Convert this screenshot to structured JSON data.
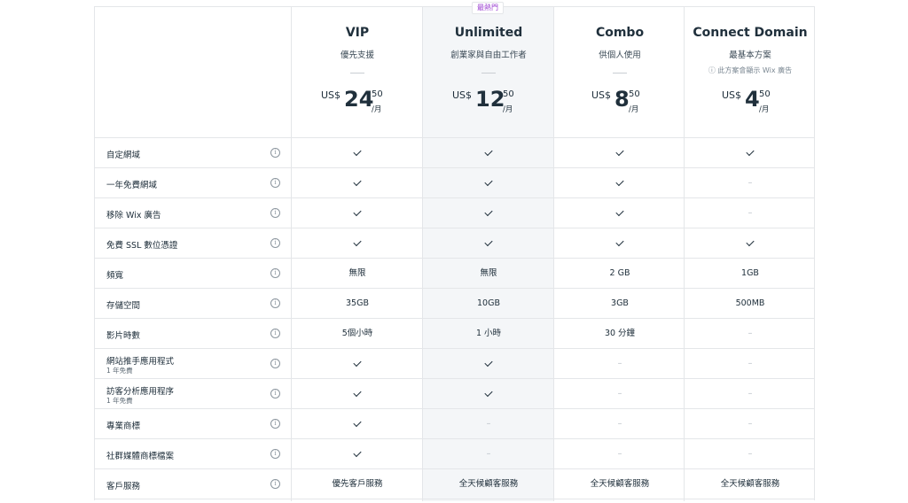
{
  "badge": "最熱門",
  "plans": [
    {
      "name": "VIP",
      "desc": "優先支援",
      "note": "",
      "currency": "US$",
      "int": "24",
      "dec": "50",
      "per": "/月"
    },
    {
      "name": "Unlimited",
      "desc": "創業家與自由工作者",
      "note": "",
      "currency": "US$",
      "int": "12",
      "dec": "50",
      "per": "/月"
    },
    {
      "name": "Combo",
      "desc": "供個人使用",
      "note": "",
      "currency": "US$",
      "int": "8",
      "dec": "50",
      "per": "/月"
    },
    {
      "name": "Connect Domain",
      "desc": "最基本方案",
      "note": "ⓘ 此方案會顯示 Wix 廣告",
      "currency": "US$",
      "int": "4",
      "dec": "50",
      "per": "/月"
    }
  ],
  "dash": "–",
  "features": [
    {
      "label": "自定網域",
      "sub": "",
      "values": [
        "check",
        "check",
        "check",
        "check"
      ]
    },
    {
      "label": "一年免費網域",
      "sub": "",
      "values": [
        "check",
        "check",
        "check",
        "dash"
      ]
    },
    {
      "label": "移除 Wix 廣告",
      "sub": "",
      "values": [
        "check",
        "check",
        "check",
        "dash"
      ]
    },
    {
      "label": "免費 SSL 數位憑證",
      "sub": "",
      "values": [
        "check",
        "check",
        "check",
        "check"
      ]
    },
    {
      "label": "頻寬",
      "sub": "",
      "values": [
        "無限",
        "無限",
        "2 GB",
        "1GB"
      ]
    },
    {
      "label": "存儲空間",
      "sub": "",
      "values": [
        "35GB",
        "10GB",
        "3GB",
        "500MB"
      ]
    },
    {
      "label": "影片時數",
      "sub": "",
      "values": [
        "5個小時",
        "1 小時",
        "30 分鐘",
        "dash"
      ]
    },
    {
      "label": "網站推手應用程式",
      "sub": "1 年免費",
      "values": [
        "check",
        "check",
        "dash",
        "dash"
      ]
    },
    {
      "label": "訪客分析應用程序",
      "sub": "1 年免費",
      "values": [
        "check",
        "check",
        "dash",
        "dash"
      ]
    },
    {
      "label": "專業商標",
      "sub": "",
      "values": [
        "check",
        "dash",
        "dash",
        "dash"
      ]
    },
    {
      "label": "社群媒體商標檔案",
      "sub": "",
      "values": [
        "check",
        "dash",
        "dash",
        "dash"
      ]
    },
    {
      "label": "客戶服務",
      "sub": "",
      "values": [
        "優先客戶服務",
        "全天候顧客服務",
        "全天候顧客服務",
        "全天候顧客服務"
      ]
    }
  ]
}
